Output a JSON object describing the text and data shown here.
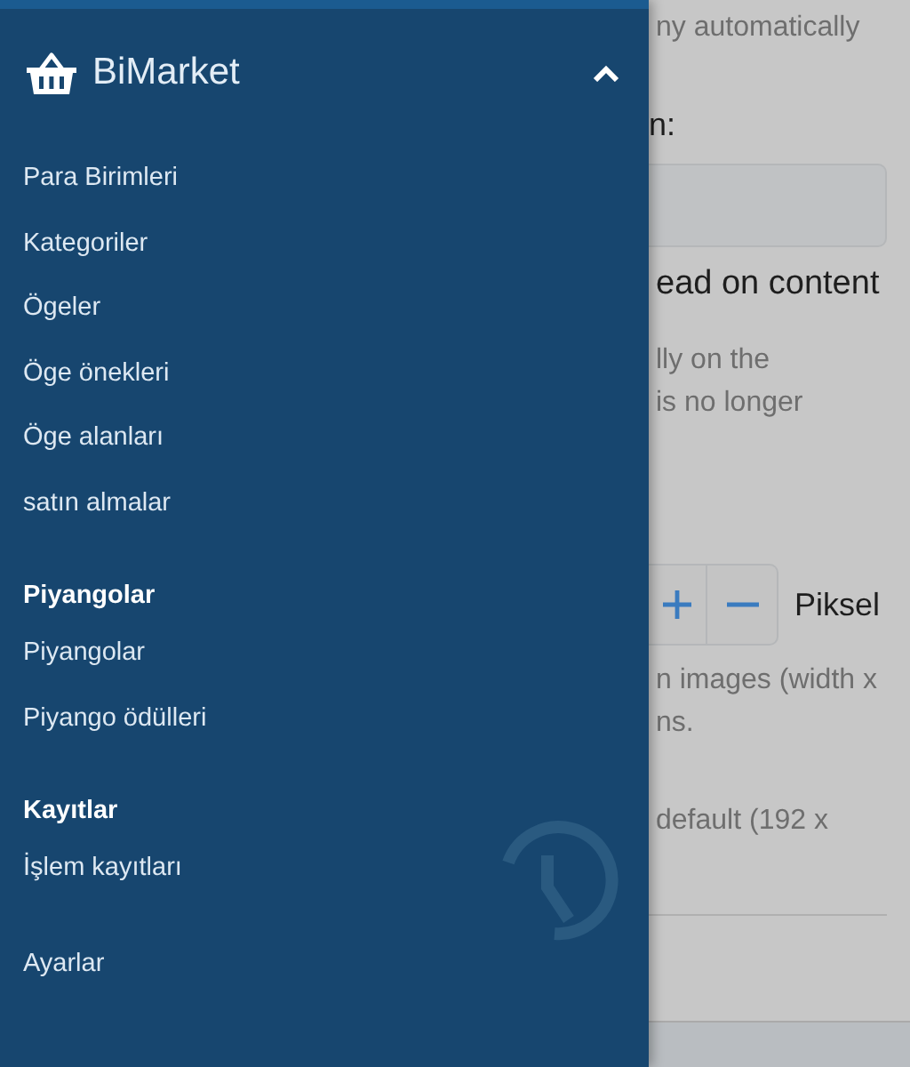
{
  "drawer": {
    "title": "BiMarket",
    "expanded": true,
    "sections": [
      {
        "items": [
          "Para Birimleri",
          "Kategoriler",
          "Ögeler",
          "Öge önekleri",
          "Öge alanları",
          "satın almalar"
        ]
      },
      {
        "heading": "Piyangolar",
        "items": [
          "Piyangolar",
          "Piyango ödülleri"
        ]
      },
      {
        "heading": "Kayıtlar",
        "items": [
          "İşlem kayıtları"
        ]
      },
      {
        "items": [
          "Ayarlar"
        ]
      }
    ]
  },
  "background": {
    "line_1": "ny automatically",
    "label": "n:",
    "option": "ead on content",
    "hint_1": "lly on the",
    "hint_2": "is no longer",
    "unit": "Piksel",
    "size_hint_1": "n images (width x",
    "size_hint_2": "ns.",
    "default_hint": "default (192 x"
  }
}
